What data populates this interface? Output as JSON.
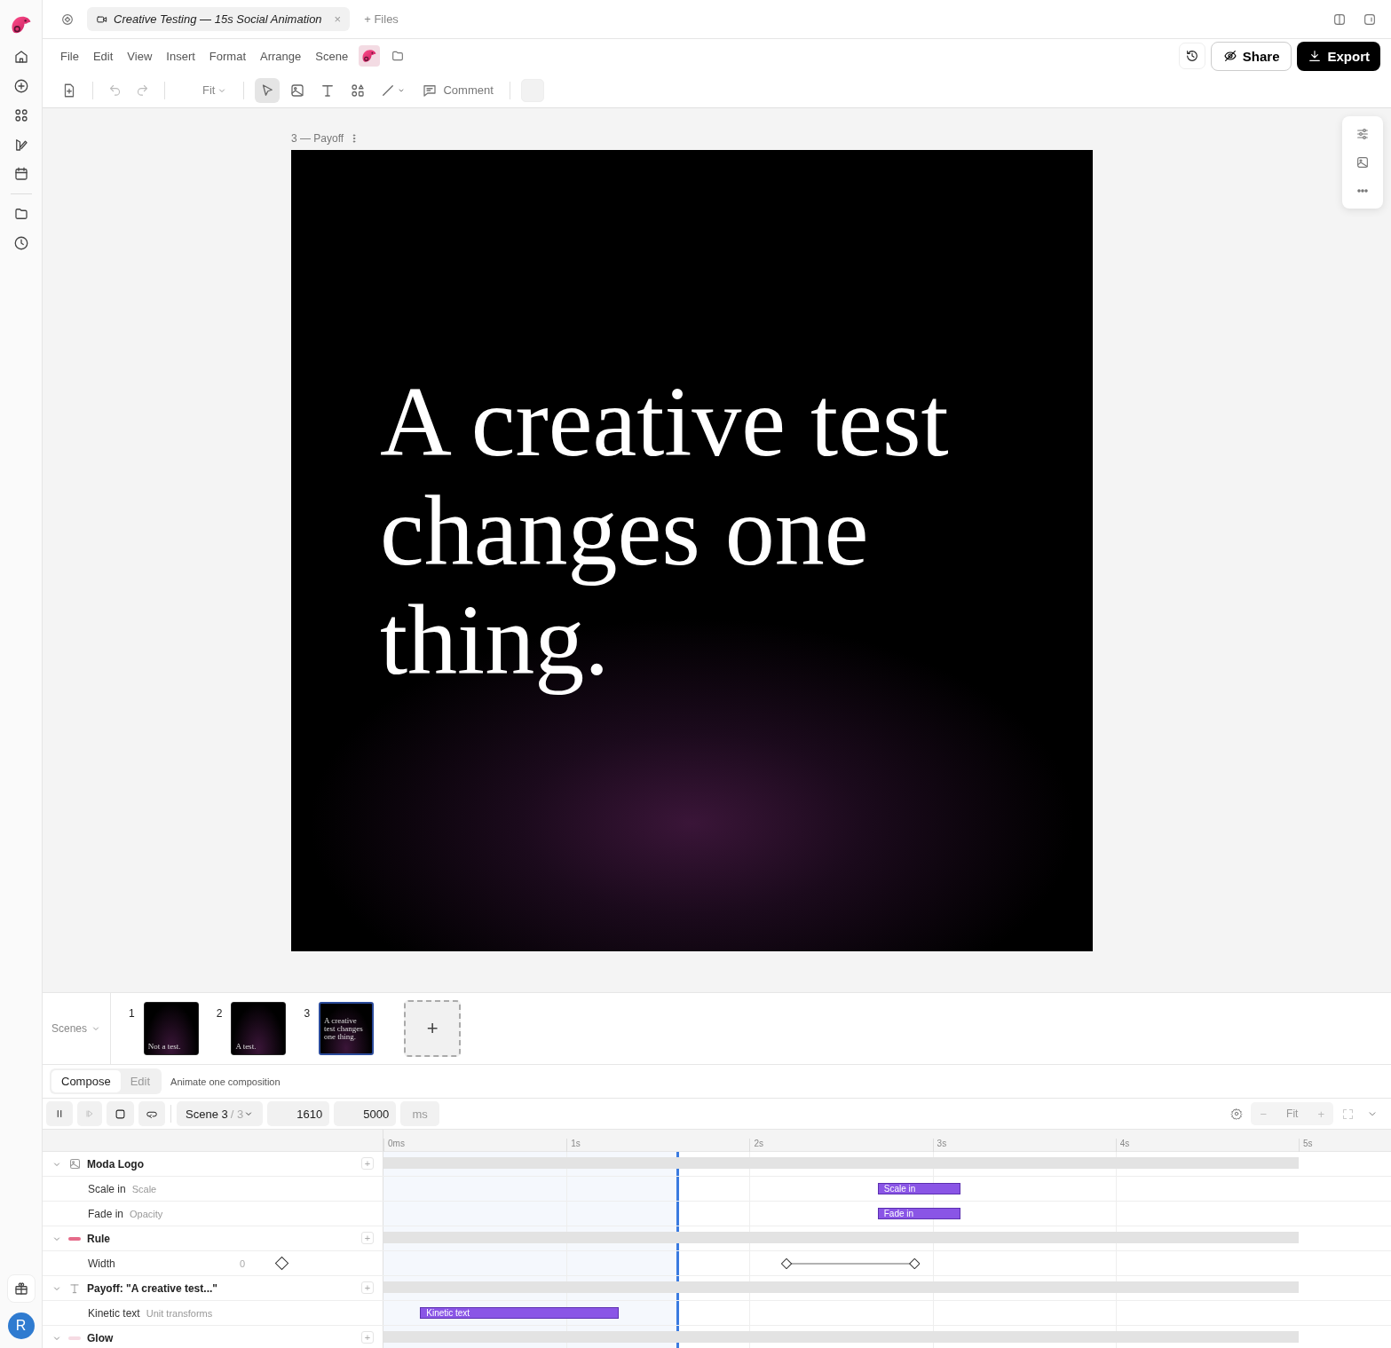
{
  "document_tab": {
    "title": "Creative Testing — 15s Social Animation",
    "close": "×"
  },
  "files_button": {
    "label": "Files",
    "icon": "+"
  },
  "menu": [
    "File",
    "Edit",
    "View",
    "Insert",
    "Format",
    "Arrange",
    "Scene"
  ],
  "actions": {
    "share": "Share",
    "export": "Export"
  },
  "toolbar": {
    "zoom": "Fit",
    "comment": "Comment",
    "tools": [
      {
        "kind": "select",
        "selected": true
      },
      {
        "kind": "image",
        "selected": false
      },
      {
        "kind": "text",
        "selected": false
      },
      {
        "kind": "shapes",
        "selected": false
      },
      {
        "kind": "line",
        "selected": false
      }
    ]
  },
  "frame": {
    "label": "3 — Payoff",
    "headline": "A creative test changes one thing."
  },
  "scenes": {
    "label": "Scenes",
    "items": [
      {
        "number": "1",
        "caption": "Not a test.",
        "selected": false
      },
      {
        "number": "2",
        "caption": "A test.",
        "selected": false
      },
      {
        "number": "3",
        "caption": "A creative test changes one thing.",
        "selected": true
      }
    ],
    "add": "+"
  },
  "modes": {
    "tabs": [
      {
        "label": "Compose",
        "selected": true
      },
      {
        "label": "Edit",
        "selected": false
      }
    ],
    "hint": "Animate one composition"
  },
  "transport": {
    "playing": true,
    "scene": "Scene 3",
    "scene_total": "/ 3",
    "current": "1610",
    "duration": "5000",
    "unit": "ms",
    "zoom": "Fit",
    "minus": "−",
    "plus": "+"
  },
  "ruler": [
    "0ms",
    "1s",
    "2s",
    "3s",
    "4s",
    "5s"
  ],
  "playhead": {
    "level": 0.322
  },
  "tracks": [
    {
      "name": "Moda Logo",
      "kind": "image",
      "expanded": true,
      "children": [
        {
          "name": "Scale in",
          "property": "Scale",
          "clip": "Scale in"
        },
        {
          "name": "Fade in",
          "property": "Opacity",
          "clip": "Fade in"
        }
      ]
    },
    {
      "name": "Rule",
      "kind": "rule",
      "expanded": true,
      "children": [
        {
          "name": "Width",
          "value": "0",
          "keyframes": true
        }
      ]
    },
    {
      "name": "Payoff: \"A creative test...\"",
      "kind": "text",
      "expanded": true,
      "children": [
        {
          "name": "Kinetic text",
          "property": "Unit transforms",
          "clip": "Kinetic text"
        }
      ]
    },
    {
      "name": "Glow",
      "kind": "glow",
      "expanded": true
    }
  ],
  "user": {
    "initial": "R"
  }
}
